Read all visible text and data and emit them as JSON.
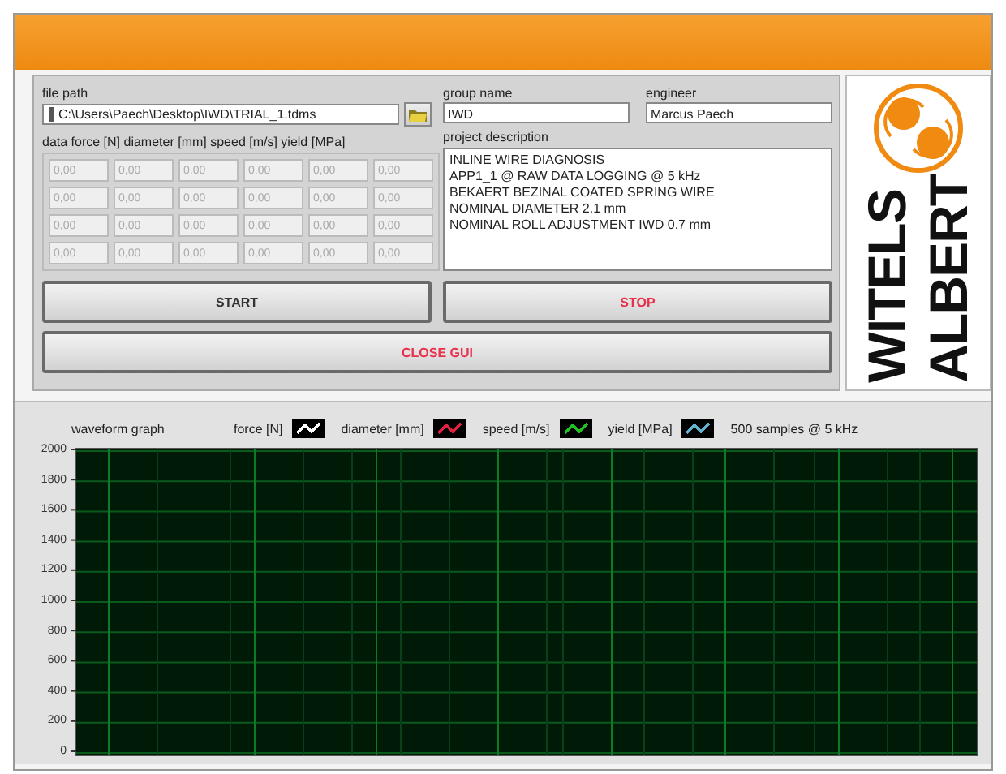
{
  "file_path": {
    "label": "file path",
    "value": "C:\\Users\\Paech\\Desktop\\IWD\\TRIAL_1.tdms"
  },
  "data_table": {
    "label": "data force [N] diameter [mm] speed [m/s] yield [MPa]",
    "disabled": true,
    "rows": [
      [
        "0,00",
        "0,00",
        "0,00",
        "0,00",
        "0,00",
        "0,00"
      ],
      [
        "0,00",
        "0,00",
        "0,00",
        "0,00",
        "0,00",
        "0,00"
      ],
      [
        "0,00",
        "0,00",
        "0,00",
        "0,00",
        "0,00",
        "0,00"
      ],
      [
        "0,00",
        "0,00",
        "0,00",
        "0,00",
        "0,00",
        "0,00"
      ]
    ]
  },
  "group_name": {
    "label": "group name",
    "value": "IWD"
  },
  "engineer": {
    "label": "engineer",
    "value": "Marcus Paech"
  },
  "project_description": {
    "label": "project description",
    "lines": [
      "INLINE WIRE DIAGNOSIS",
      "APP1_1 @ RAW DATA LOGGING @ 5 kHz",
      "BEKAERT BEZINAL COATED SPRING WIRE",
      "NOMINAL DIAMETER 2.1 mm",
      "NOMINAL ROLL ADJUSTMENT IWD 0.7 mm"
    ]
  },
  "buttons": [
    {
      "label": "START",
      "kind": "normal"
    },
    {
      "label": "STOP",
      "kind": "alert"
    },
    {
      "label": "CLOSE GUI",
      "kind": "alert"
    }
  ],
  "logo": {
    "words": [
      "WITELS",
      "ALBERT"
    ]
  },
  "graph": {
    "title": "waveform graph",
    "note": "500 samples @ 5 kHz",
    "legend": [
      {
        "name": "force [N]",
        "color": "#ffffff"
      },
      {
        "name": "diameter [mm]",
        "color": "#e0203c"
      },
      {
        "name": "speed [m/s]",
        "color": "#20c020"
      },
      {
        "name": "yield [MPa]",
        "color": "#60b0d0"
      }
    ],
    "yticks": [
      "2000",
      "1800",
      "1600",
      "1400",
      "1200",
      "1000",
      "800",
      "600",
      "400",
      "200",
      "0"
    ]
  }
}
